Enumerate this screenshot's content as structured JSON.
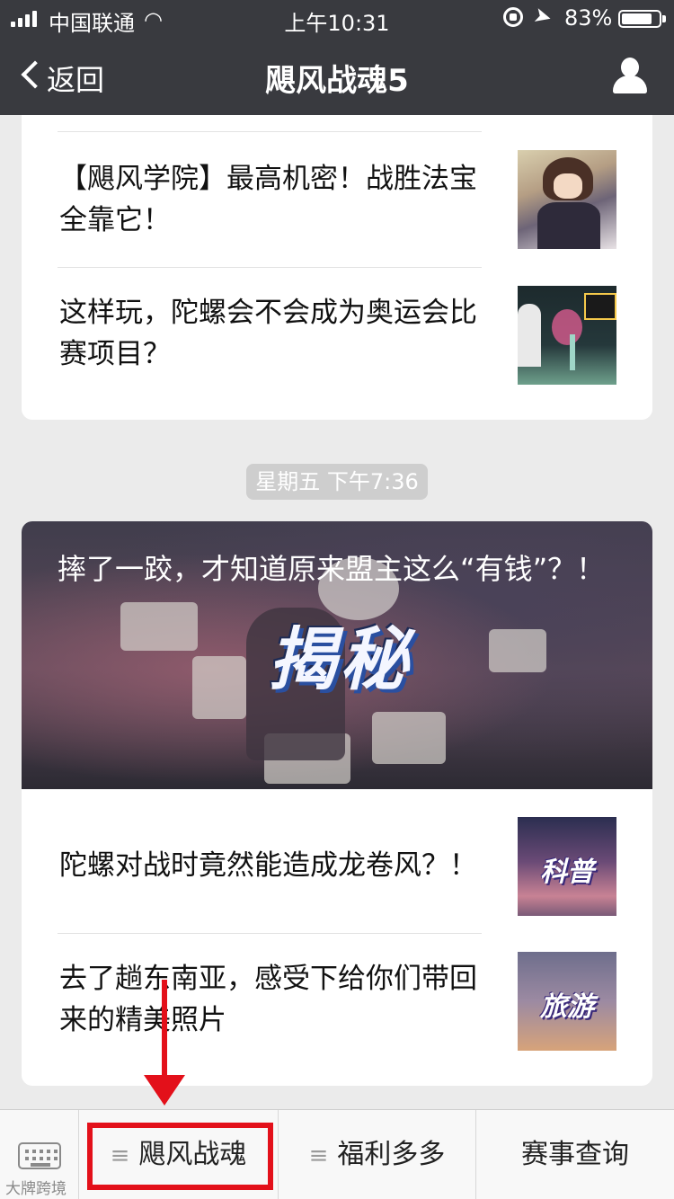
{
  "status_bar": {
    "carrier": "中国联通",
    "time": "上午10:31",
    "battery": "83%",
    "battery_level": 0.83
  },
  "nav": {
    "back_label": "返回",
    "title": "飓风战魂5"
  },
  "card1": {
    "articles": [
      {
        "title": "【飓风学院】最高机密！战胜法宝全靠它！"
      },
      {
        "title": "这样玩，陀螺会不会成为奥运会比赛项目？"
      }
    ]
  },
  "timestamp": "星期五 下午7:36",
  "card2": {
    "hero": {
      "title": "摔了一跤，才知道原来盟主这么“有钱”？！",
      "badge": "揭秘"
    },
    "articles": [
      {
        "title": "陀螺对战时竟然能造成龙卷风？！",
        "thumb_label": "科普"
      },
      {
        "title": "去了趟东南亚，感受下给你们带回来的精美照片",
        "thumb_label": "旅游"
      }
    ]
  },
  "menu": {
    "items": [
      {
        "label": "飓风战魂",
        "icon": "hamburger-icon"
      },
      {
        "label": "福利多多",
        "icon": "hamburger-icon"
      },
      {
        "label": "赛事查询"
      }
    ],
    "keyboard_icon": "keyboard-icon"
  },
  "watermark": "大牌跨境",
  "colors": {
    "nav_bg": "#393a3f",
    "highlight": "#e3101a",
    "page_bg": "#ebebeb"
  }
}
